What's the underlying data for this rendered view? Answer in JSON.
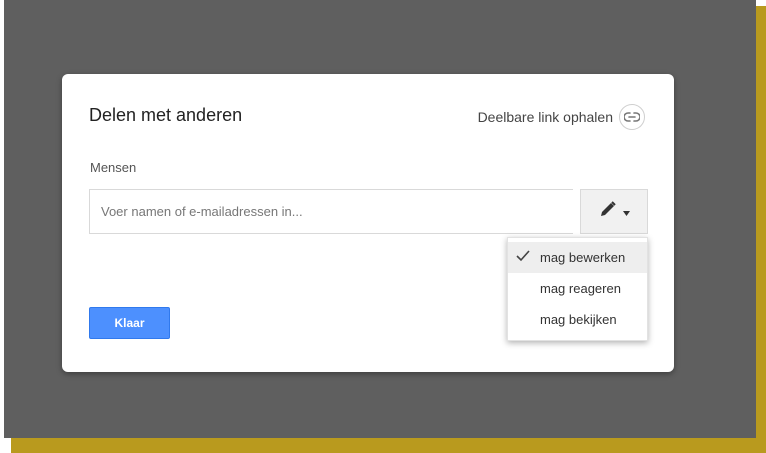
{
  "dialog": {
    "title": "Delen met anderen",
    "share_link_label": "Deelbare link ophalen",
    "people_label": "Mensen",
    "input_placeholder": "Voer namen of e-mailadressen in...",
    "input_value": "",
    "permission_options": [
      {
        "label": "mag bewerken",
        "selected": true
      },
      {
        "label": "mag reageren",
        "selected": false
      },
      {
        "label": "mag bekijken",
        "selected": false
      }
    ],
    "done_label": "Klaar"
  },
  "colors": {
    "overlay": "#5f5f5f",
    "frame_accent": "#b99a1e",
    "primary_button": "#4d90fe",
    "menu_selected_bg": "#eeeeee"
  },
  "icons": [
    "link-icon",
    "pencil-icon",
    "caret-down-icon",
    "check-icon"
  ]
}
